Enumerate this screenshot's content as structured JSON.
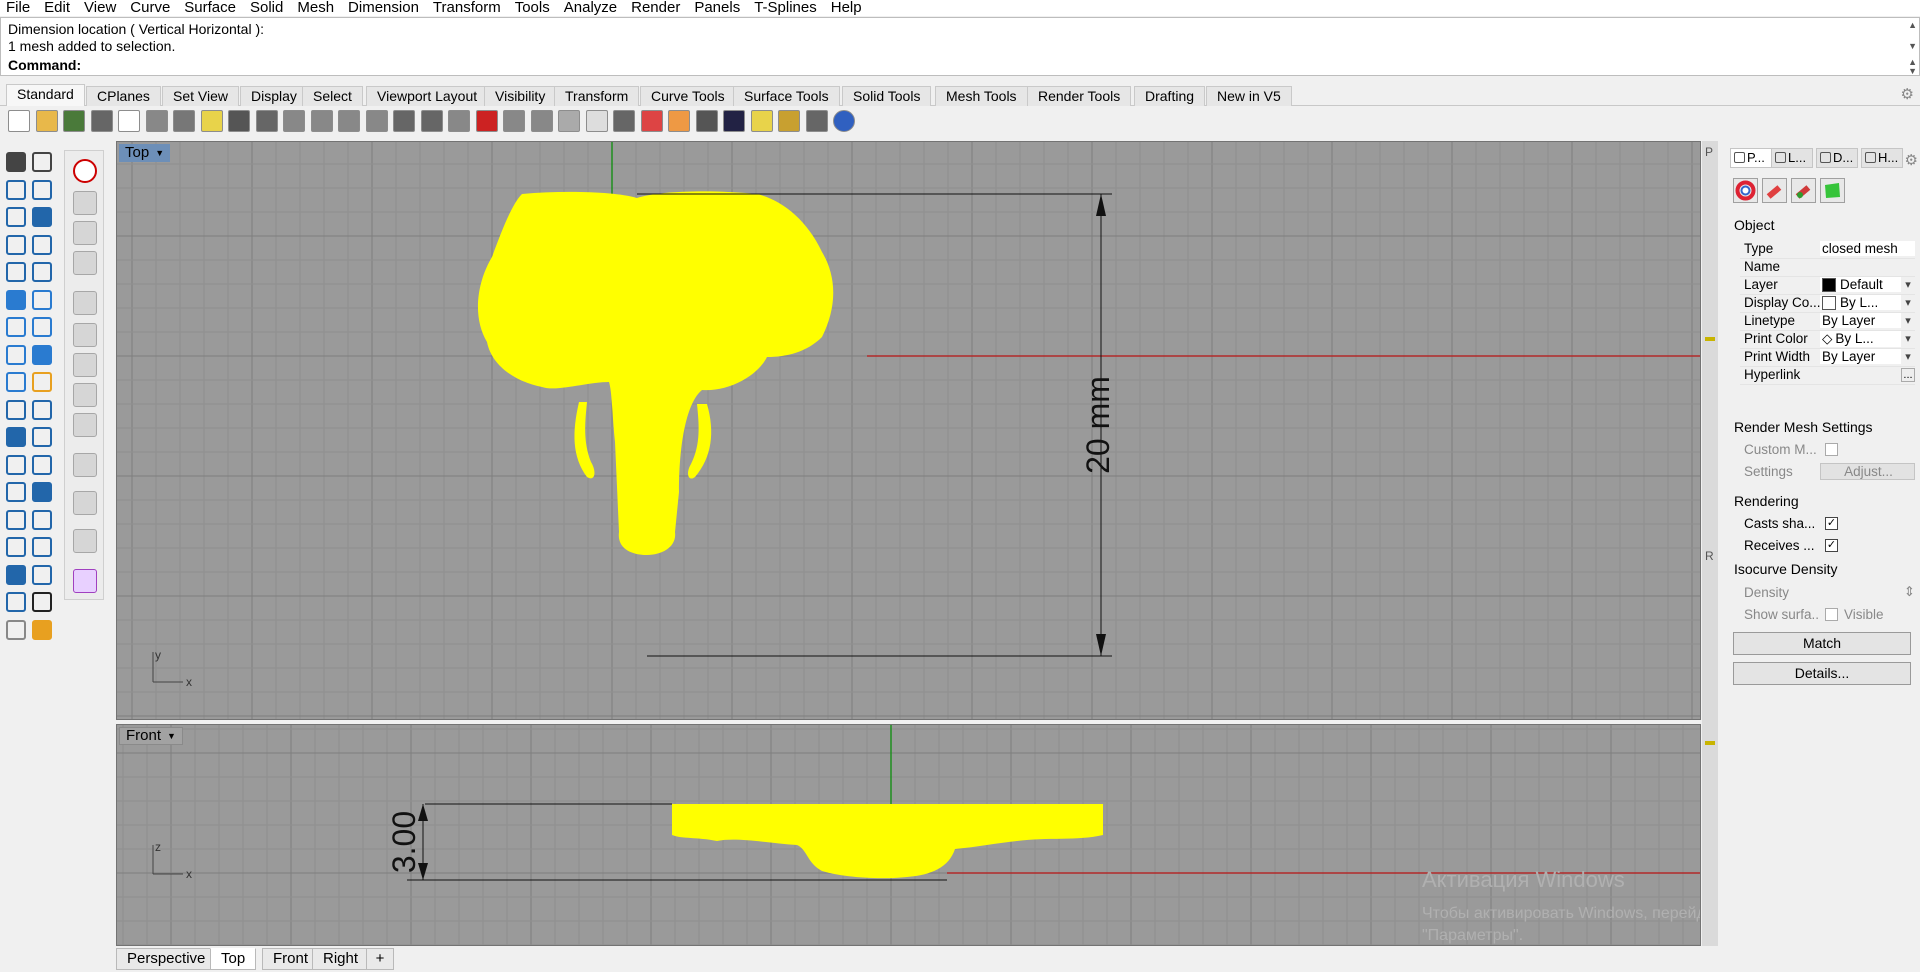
{
  "menu": [
    "File",
    "Edit",
    "View",
    "Curve",
    "Surface",
    "Solid",
    "Mesh",
    "Dimension",
    "Transform",
    "Tools",
    "Analyze",
    "Render",
    "Panels",
    "T-Splines",
    "Help"
  ],
  "history": {
    "line1": "Dimension location ( Vertical  Horizontal ):",
    "line2": "1 mesh added to selection."
  },
  "command": {
    "label": "Command:",
    "value": ""
  },
  "toolbar_tabs": [
    "Standard",
    "CPlanes",
    "Set View",
    "Display",
    "Select",
    "Viewport Layout",
    "Visibility",
    "Transform",
    "Curve Tools",
    "Surface Tools",
    "Solid Tools",
    "Mesh Tools",
    "Render Tools",
    "Drafting",
    "New in V5"
  ],
  "active_toolbar_tab": "Standard",
  "viewports": {
    "top": {
      "title": "Top",
      "dimension": "20 mm",
      "axis_x": "x",
      "axis_y": "y"
    },
    "front": {
      "title": "Front",
      "dimension": "3.00",
      "axis_x": "x",
      "axis_z": "z"
    }
  },
  "viewport_tabs": [
    "Perspective",
    "Top",
    "Front",
    "Right"
  ],
  "active_viewport_tab": "Top",
  "viewport_add_icon": "plus-icon",
  "side_labels": {
    "p": "P",
    "r": "R"
  },
  "watermark": {
    "line1": "Активация Windows",
    "line2": "Чтобы активировать Windows, перейдите в раздел",
    "line3": "\"Параметры\"."
  },
  "panel": {
    "tabs": [
      "P...",
      "L...",
      "D...",
      "H..."
    ],
    "object_section": "Object",
    "rows": [
      {
        "label": "Type",
        "value": "closed mesh"
      },
      {
        "label": "Name",
        "value": ""
      },
      {
        "label": "Layer",
        "value": "Default"
      },
      {
        "label": "Display Co...",
        "value": "By L..."
      },
      {
        "label": "Linetype",
        "value": "By Layer"
      },
      {
        "label": "Print Color",
        "value": "By L..."
      },
      {
        "label": "Print Width",
        "value": "By Layer"
      },
      {
        "label": "Hyperlink",
        "value": ""
      }
    ],
    "render_mesh_section": "Render Mesh Settings",
    "render_rows": [
      {
        "label": "Custom M...",
        "value": ""
      },
      {
        "label": "Settings",
        "value": "Adjust..."
      }
    ],
    "rendering_section": "Rendering",
    "rendering_rows": [
      {
        "label": "Casts sha...",
        "checked": true
      },
      {
        "label": "Receives ...",
        "checked": true
      }
    ],
    "isocurve_section": "Isocurve Density",
    "isocurve_rows": [
      {
        "label": "Density",
        "value": ""
      },
      {
        "label": "Show surfa...",
        "value": "Visible"
      }
    ],
    "match_button": "Match",
    "details_button": "Details..."
  },
  "colors": {
    "mesh": "#ffff00",
    "viewport_bg": "#9a9a9a",
    "grid_major": "#8a8a8a",
    "x_axis": "#b22a2a",
    "y_axis": "#1f8f1f",
    "active_view_title": "#6d8fb8"
  }
}
